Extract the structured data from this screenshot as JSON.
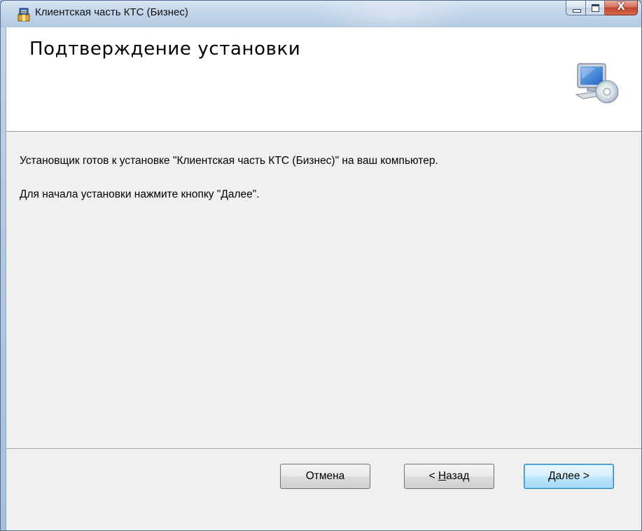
{
  "window": {
    "title": "Клиентская часть КТС (Бизнес)",
    "icons": {
      "app": "installer-package-icon",
      "minimize": "minimize-icon",
      "maximize": "maximize-icon",
      "close": "close-icon",
      "banner": "computer-with-cd-icon"
    },
    "close_glyph": "X"
  },
  "banner": {
    "title": "Подтверждение установки"
  },
  "content": {
    "line1": "Установщик готов к установке \"Клиентская часть КТС (Бизнес)\" на ваш компьютер.",
    "line2": "Для начала установки нажмите кнопку \"Далее\"."
  },
  "buttons": {
    "cancel": "Отмена",
    "back_prefix": "< ",
    "back_mnemonic": "Н",
    "back_rest": "азад",
    "next": "Далее >"
  },
  "colors": {
    "default_button_border": "#3c7fb1",
    "close_button": "#c2432e"
  }
}
